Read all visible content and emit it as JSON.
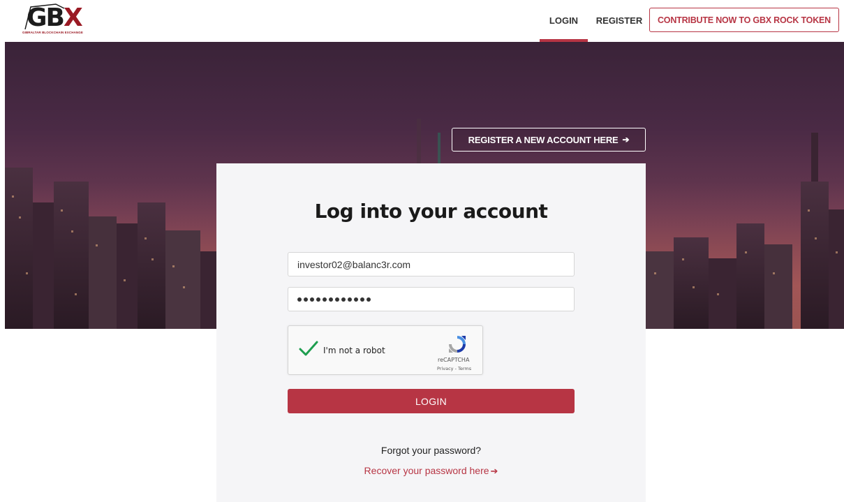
{
  "header": {
    "logo_text": "GBX",
    "logo_subtitle": "GIBRALTAR BLOCKCHAIN EXCHANGE",
    "nav": {
      "login": "LOGIN",
      "register": "REGISTER",
      "contribute": "CONTRIBUTE NOW TO GBX ROCK TOKEN"
    }
  },
  "hero": {
    "register_new_label": "REGISTER A NEW ACCOUNT HERE",
    "arrow_icon": "arrow-right-icon"
  },
  "login_form": {
    "title": "Log into your account",
    "email_value": "investor02@balanc3r.com",
    "password_length": 12,
    "captcha": {
      "label": "I'm not a robot",
      "brand": "reCAPTCHA",
      "terms": "Privacy - Terms",
      "checked": true
    },
    "login_button": "LOGIN",
    "forgot_text": "Forgot your password?",
    "recover_link": "Recover your password here"
  },
  "colors": {
    "accent": "#b73544",
    "check": "#1e9e4f"
  }
}
